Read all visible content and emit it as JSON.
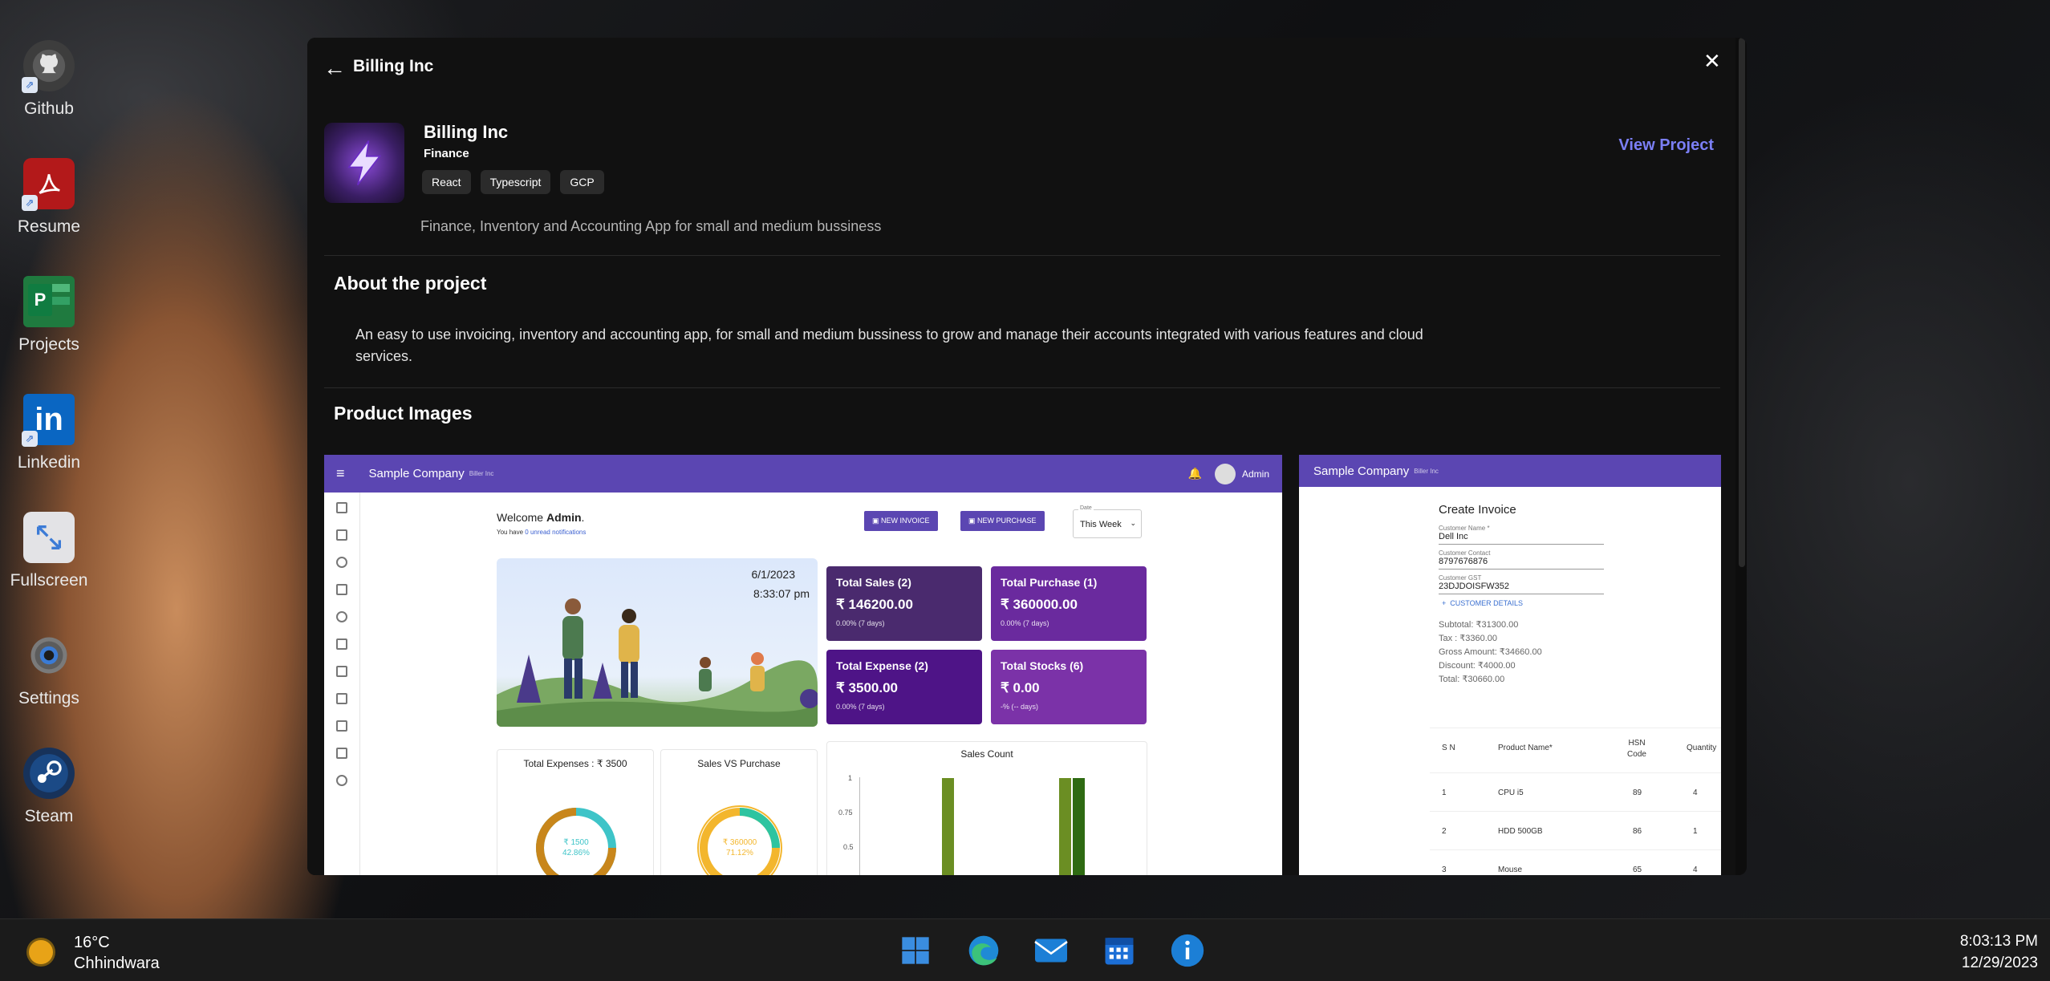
{
  "desktop": {
    "icons": [
      {
        "label": "Github",
        "icon": "github-icon"
      },
      {
        "label": "Resume",
        "icon": "pdf-icon"
      },
      {
        "label": "Projects",
        "icon": "project-icon"
      },
      {
        "label": "Linkedin",
        "icon": "linkedin-icon"
      },
      {
        "label": "Fullscreen",
        "icon": "fullscreen-icon"
      },
      {
        "label": "Settings",
        "icon": "gear-icon"
      },
      {
        "label": "Steam",
        "icon": "steam-icon"
      }
    ]
  },
  "modal": {
    "back_glyph": "←",
    "title": "Billing Inc",
    "close_glyph": "✕",
    "project": {
      "name": "Billing Inc",
      "category": "Finance",
      "tags": [
        "React",
        "Typescript",
        "GCP"
      ],
      "view_link": "View Project",
      "description": "Finance, Inventory and Accounting App for small and medium bussiness"
    },
    "about": {
      "heading": "About the project",
      "text": "An easy to use invoicing, inventory and accounting app, for small and medium bussiness to grow and manage their accounts integrated with various features and cloud services."
    },
    "images": {
      "heading": "Product Images"
    }
  },
  "shot1": {
    "company": "Sample Company",
    "company_sub": "Biller Inc",
    "user": "Admin",
    "welcome_prefix": "Welcome ",
    "welcome_name": "Admin",
    "notif_prefix": "You have ",
    "notif_link": "0 unread notifications",
    "btn_invoice": "NEW INVOICE",
    "btn_purchase": "NEW PURCHASE",
    "date_label": "Date",
    "date_value": "This Week",
    "hero_date": "6/1/2023",
    "hero_time": "8:33:07 pm",
    "cards": [
      {
        "title": "Total Sales (2)",
        "value": "₹ 146200.00",
        "sub": "0.00% (7 days)",
        "color": "#4a2a6e"
      },
      {
        "title": "Total Purchase (1)",
        "value": "₹ 360000.00",
        "sub": "0.00% (7 days)",
        "color": "#6a2a9e"
      },
      {
        "title": "Total Expense (2)",
        "value": "₹ 3500.00",
        "sub": "0.00% (7 days)",
        "color": "#4e1487"
      },
      {
        "title": "Total Stocks (6)",
        "value": "₹ 0.00",
        "sub": "-% (-- days)",
        "color": "#7b32a8"
      }
    ],
    "panel1": {
      "title": "Total Expenses : ₹ 3500",
      "center1": "₹ 1500",
      "center2": "42.86%"
    },
    "panel2": {
      "title": "Sales VS Purchase",
      "center1": "₹ 360000",
      "center2": "71.12%"
    },
    "panel3": {
      "title": "Sales Count",
      "ticks": [
        "1",
        "0.75",
        "0.5"
      ]
    }
  },
  "shot2": {
    "company": "Sample Company",
    "company_sub": "Biller Inc",
    "form_title": "Create Invoice",
    "fields": [
      {
        "label": "Customer Name *",
        "value": "Dell Inc"
      },
      {
        "label": "Customer Contact",
        "value": "8797676876"
      },
      {
        "label": "Customer GST",
        "value": "23DJDOISFW352"
      }
    ],
    "customer_details": "CUSTOMER DETAILS",
    "totals": [
      "Subtotal: ₹31300.00",
      "Tax : ₹3360.00",
      "Gross Amount: ₹34660.00",
      "Discount: ₹4000.00",
      "Total: ₹30660.00"
    ],
    "columns": [
      "S N",
      "Product Name*",
      "HSN Code",
      "Quantity"
    ],
    "rows": [
      {
        "sn": "1",
        "name": "CPU i5",
        "hsn": "89",
        "qty": "4"
      },
      {
        "sn": "2",
        "name": "HDD 500GB",
        "hsn": "86",
        "qty": "1"
      },
      {
        "sn": "3",
        "name": "Mouse",
        "hsn": "65",
        "qty": "4"
      }
    ]
  },
  "taskbar": {
    "temp": "16°C",
    "city": "Chhindwara",
    "time": "8:03:13 PM",
    "date": "12/29/2023",
    "apps": [
      "start-icon",
      "edge-icon",
      "mail-icon",
      "calendar-icon",
      "info-icon"
    ]
  }
}
